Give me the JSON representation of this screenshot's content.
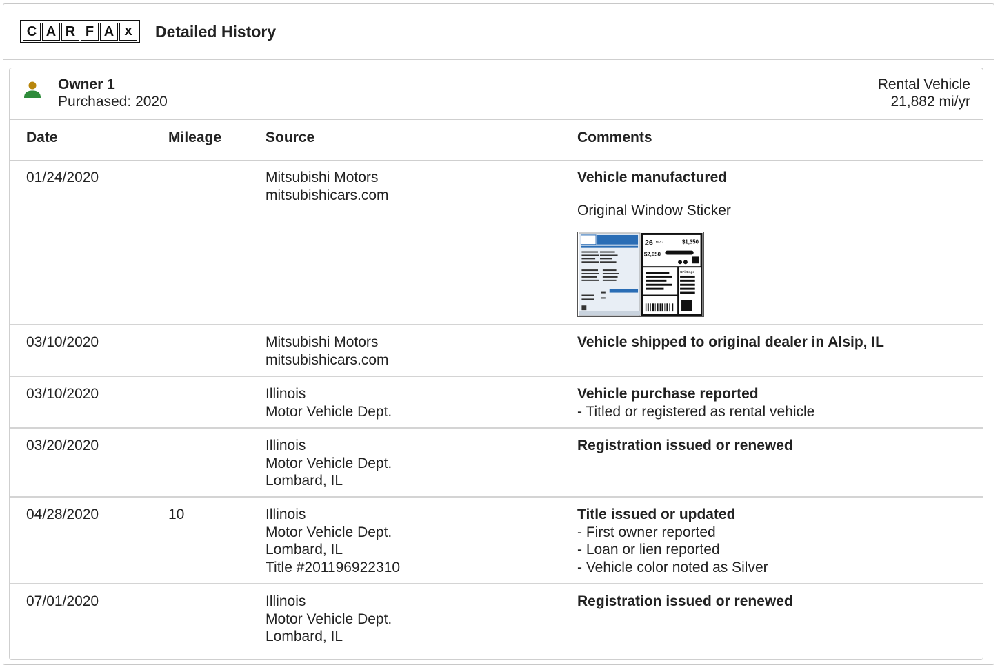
{
  "header": {
    "logo_letters": [
      "C",
      "A",
      "R",
      "F",
      "A",
      "x"
    ],
    "title": "Detailed History"
  },
  "owner": {
    "icon": "person-icon",
    "name": "Owner 1",
    "purchased": "Purchased: 2020",
    "type": "Rental Vehicle",
    "miles": "21,882 mi/yr",
    "icon_colors": {
      "head": "#b8860b",
      "body": "#2e8b3a"
    }
  },
  "table": {
    "headers": {
      "date": "Date",
      "mileage": "Mileage",
      "source": "Source",
      "comments": "Comments"
    },
    "rows": [
      {
        "date": "01/24/2020",
        "mileage": "",
        "source": [
          "Mitsubishi Motors",
          "mitsubishicars.com"
        ],
        "comment_title": "Vehicle manufactured",
        "comment_lines": [],
        "sticker_label": "Original Window Sticker",
        "sticker_text": {
          "mpg": "26",
          "mpg_unit": "MPG",
          "save": "$1,350",
          "fuel_cost": "$2,050",
          "fitting": "SFittings"
        }
      },
      {
        "date": "03/10/2020",
        "mileage": "",
        "source": [
          "Mitsubishi Motors",
          "mitsubishicars.com"
        ],
        "comment_title": "Vehicle shipped to original dealer in Alsip, IL",
        "comment_lines": []
      },
      {
        "date": "03/10/2020",
        "mileage": "",
        "source": [
          "Illinois",
          "Motor Vehicle Dept."
        ],
        "comment_title": "Vehicle purchase reported",
        "comment_lines": [
          "- Titled or registered as rental vehicle"
        ]
      },
      {
        "date": "03/20/2020",
        "mileage": "",
        "source": [
          "Illinois",
          "Motor Vehicle Dept.",
          "Lombard, IL"
        ],
        "comment_title": "Registration issued or renewed",
        "comment_lines": []
      },
      {
        "date": "04/28/2020",
        "mileage": "10",
        "source": [
          "Illinois",
          "Motor Vehicle Dept.",
          "Lombard, IL",
          "Title #201196922310"
        ],
        "comment_title": "Title issued or updated",
        "comment_lines": [
          "- First owner reported",
          "- Loan or lien reported",
          "- Vehicle color noted as Silver"
        ]
      },
      {
        "date": "07/01/2020",
        "mileage": "",
        "source": [
          "Illinois",
          "Motor Vehicle Dept.",
          "Lombard, IL"
        ],
        "comment_title": "Registration issued or renewed",
        "comment_lines": []
      }
    ]
  }
}
